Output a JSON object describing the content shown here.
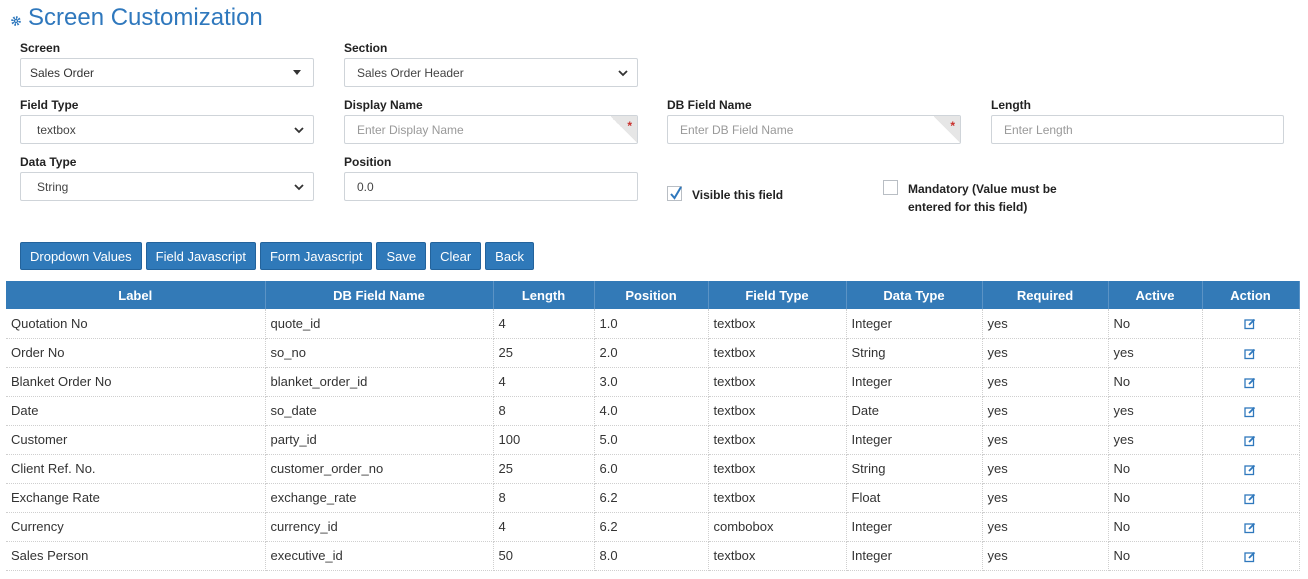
{
  "page": {
    "title": "Screen Customization",
    "title_icon": "gear-icon",
    "accent": "#337ab7"
  },
  "form": {
    "screen": {
      "label": "Screen",
      "value": "Sales Order"
    },
    "section": {
      "label": "Section",
      "value": "Sales Order Header"
    },
    "field_type": {
      "label": "Field Type",
      "value": "textbox"
    },
    "display_name": {
      "label": "Display Name",
      "placeholder": "Enter Display Name",
      "required_mark": "*"
    },
    "db_field_name": {
      "label": "DB Field Name",
      "placeholder": "Enter DB Field Name",
      "required_mark": "*"
    },
    "length": {
      "label": "Length",
      "placeholder": "Enter Length"
    },
    "data_type": {
      "label": "Data Type",
      "value": "String"
    },
    "position": {
      "label": "Position",
      "value": "0.0"
    },
    "visible": {
      "label": "Visible this field",
      "checked": true
    },
    "mandatory": {
      "label": "Mandatory (Value must be entered for this field)",
      "checked": false
    }
  },
  "buttons": {
    "dropdown_values": "Dropdown Values",
    "field_javascript": "Field Javascript",
    "form_javascript": "Form Javascript",
    "save": "Save",
    "clear": "Clear",
    "back": "Back"
  },
  "table": {
    "columns": [
      "Label",
      "DB Field Name",
      "Length",
      "Position",
      "Field Type",
      "Data Type",
      "Required",
      "Active",
      "Action"
    ],
    "rows": [
      [
        "Quotation No",
        "quote_id",
        "4",
        "1.0",
        "textbox",
        "Integer",
        "yes",
        "No"
      ],
      [
        "Order No",
        "so_no",
        "25",
        "2.0",
        "textbox",
        "String",
        "yes",
        "yes"
      ],
      [
        "Blanket Order No",
        "blanket_order_id",
        "4",
        "3.0",
        "textbox",
        "Integer",
        "yes",
        "No"
      ],
      [
        "Date",
        "so_date",
        "8",
        "4.0",
        "textbox",
        "Date",
        "yes",
        "yes"
      ],
      [
        "Customer",
        "party_id",
        "100",
        "5.0",
        "textbox",
        "Integer",
        "yes",
        "yes"
      ],
      [
        "Client Ref. No.",
        "customer_order_no",
        "25",
        "6.0",
        "textbox",
        "String",
        "yes",
        "No"
      ],
      [
        "Exchange Rate",
        "exchange_rate",
        "8",
        "6.2",
        "textbox",
        "Float",
        "yes",
        "No"
      ],
      [
        "Currency",
        "currency_id",
        "4",
        "6.2",
        "combobox",
        "Integer",
        "yes",
        "No"
      ],
      [
        "Sales Person",
        "executive_id",
        "50",
        "8.0",
        "textbox",
        "Integer",
        "yes",
        "No"
      ]
    ],
    "action_icon": "edit-icon"
  }
}
